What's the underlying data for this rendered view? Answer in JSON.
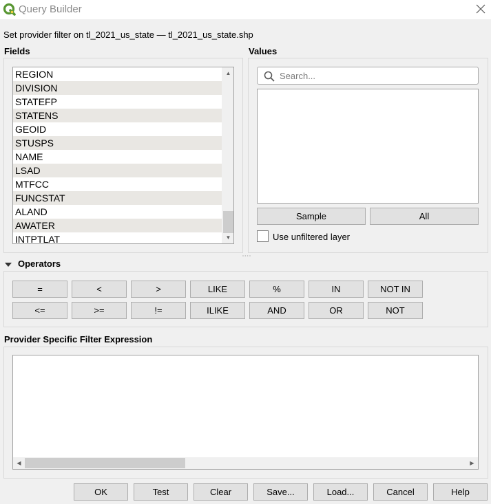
{
  "window": {
    "title": "Query Builder"
  },
  "subtitle": "Set provider filter on tl_2021_us_state — tl_2021_us_state.shp",
  "fields": {
    "title": "Fields",
    "items": [
      "REGION",
      "DIVISION",
      "STATEFP",
      "STATENS",
      "GEOID",
      "STUSPS",
      "NAME",
      "LSAD",
      "MTFCC",
      "FUNCSTAT",
      "ALAND",
      "AWATER",
      "INTPTLAT"
    ]
  },
  "values": {
    "title": "Values",
    "search_placeholder": "Search...",
    "sample_label": "Sample",
    "all_label": "All",
    "unfiltered_label": "Use unfiltered layer"
  },
  "operators": {
    "title": "Operators",
    "row1": [
      "=",
      "<",
      ">",
      "LIKE",
      "%",
      "IN",
      "NOT IN"
    ],
    "row2": [
      "<=",
      ">=",
      "!=",
      "ILIKE",
      "AND",
      "OR",
      "NOT"
    ]
  },
  "expression": {
    "title": "Provider Specific Filter Expression",
    "value": ""
  },
  "buttons": {
    "ok": "OK",
    "test": "Test",
    "clear": "Clear",
    "save": "Save...",
    "load": "Load...",
    "cancel": "Cancel",
    "help": "Help"
  },
  "colors": {
    "qgis_green": "#589632",
    "qgis_yellow": "#ee7913",
    "row_alt": "#e9e7e3"
  }
}
